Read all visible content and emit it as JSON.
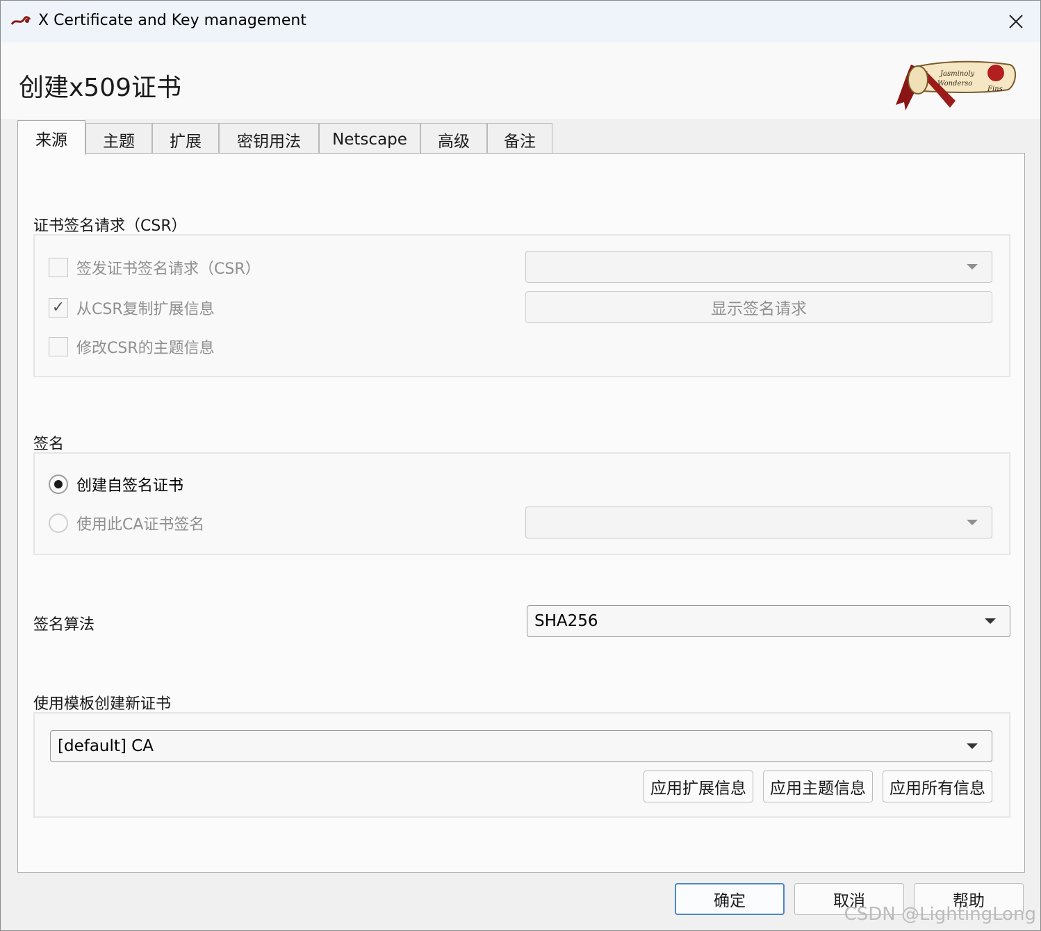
{
  "window": {
    "title": "X Certificate and Key management",
    "close_icon": "close-icon"
  },
  "heading": "创建x509证书",
  "logo_text": {
    "line1": "Jasminoly",
    "line2": "Wonderso",
    "line3": "Fins"
  },
  "tabs": [
    {
      "label": "来源",
      "active": true
    },
    {
      "label": "主题"
    },
    {
      "label": "扩展"
    },
    {
      "label": "密钥用法"
    },
    {
      "label": "Netscape"
    },
    {
      "label": "高级"
    },
    {
      "label": "备注"
    }
  ],
  "csr": {
    "label": "证书签名请求（CSR）",
    "sign_csr": {
      "label": "签发证书签名请求（CSR）",
      "checked": false
    },
    "copy_ext": {
      "label": "从CSR复制扩展信息",
      "checked": true,
      "check_mark": "✓"
    },
    "modify_subject": {
      "label": "修改CSR的主题信息",
      "checked": false
    },
    "csr_select_value": "",
    "show_request_button": "显示签名请求"
  },
  "signing": {
    "label": "签名",
    "self_signed": {
      "label": "创建自签名证书",
      "selected": true
    },
    "use_ca": {
      "label": "使用此CA证书签名",
      "selected": false
    },
    "ca_select_value": ""
  },
  "algorithm": {
    "label": "签名算法",
    "value": "SHA256"
  },
  "template": {
    "label": "使用模板创建新证书",
    "value": "[default] CA",
    "apply_ext_button": "应用扩展信息",
    "apply_subject_button": "应用主题信息",
    "apply_all_button": "应用所有信息"
  },
  "footer": {
    "ok_button": "确定",
    "cancel_button": "取消",
    "help_button": "帮助"
  },
  "watermark": "CSDN @LightingLong",
  "colors": {
    "primary_border": "#4a86c8",
    "logo_red": "#9b1b1b"
  }
}
